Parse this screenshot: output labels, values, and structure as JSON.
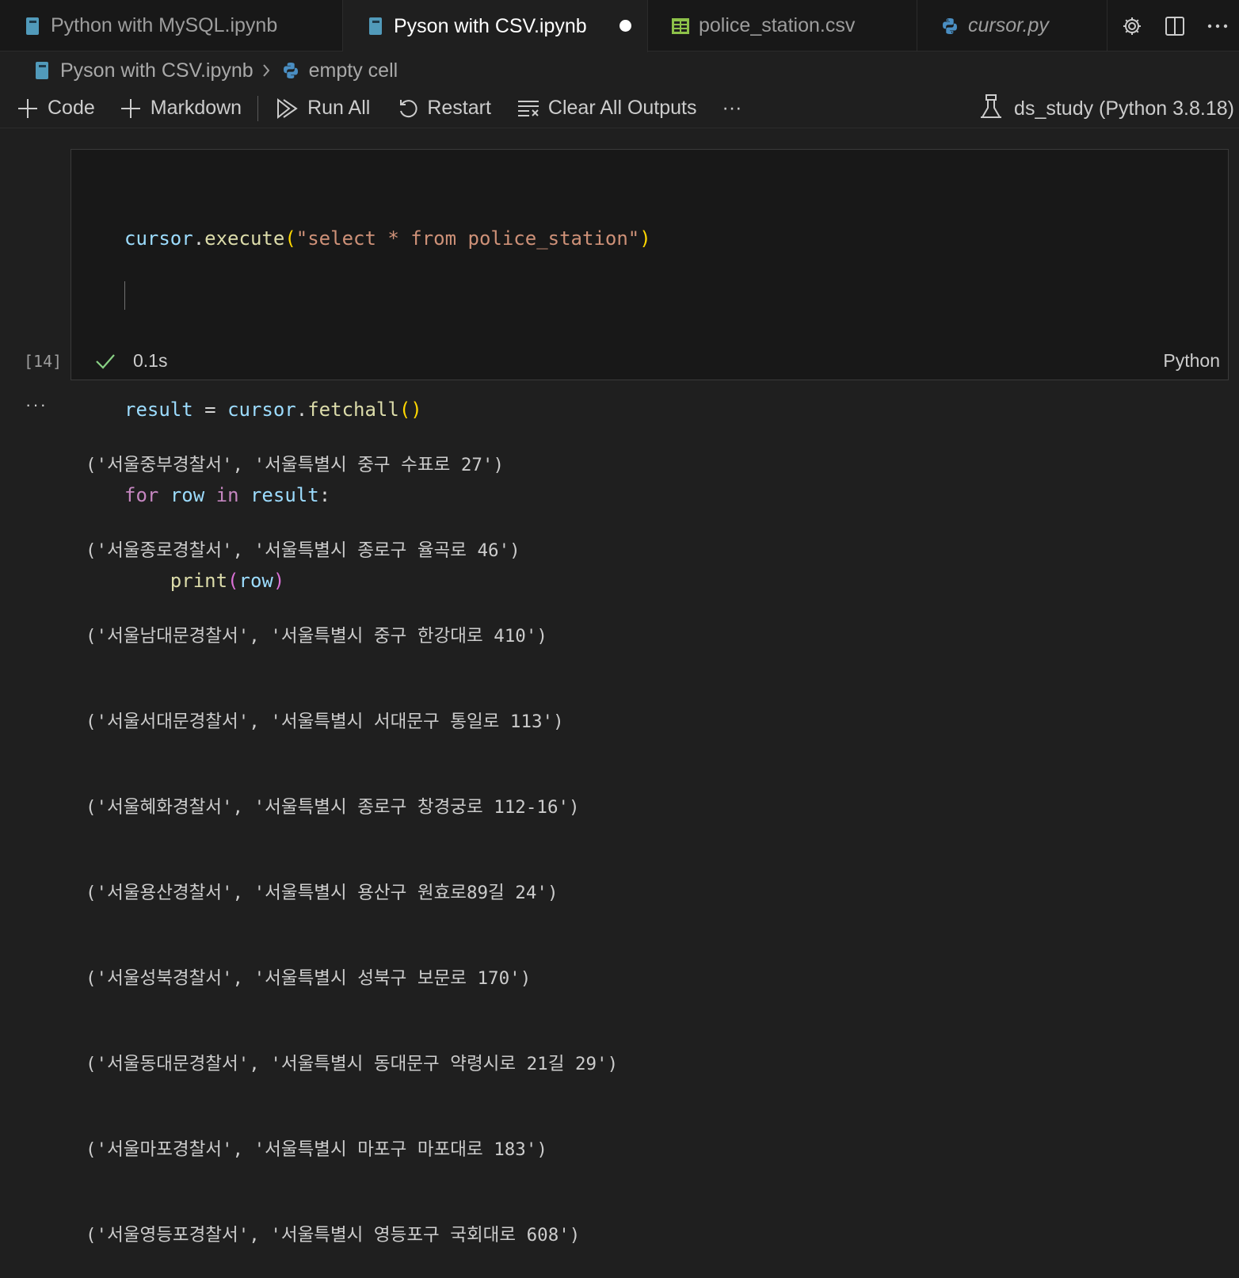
{
  "tabs": [
    {
      "label": "Python with MySQL.ipynb",
      "icon": "notebook-icon",
      "active": false
    },
    {
      "label": "Pyson with CSV.ipynb",
      "icon": "notebook-icon",
      "active": true,
      "dirty": true
    },
    {
      "label": "police_station.csv",
      "icon": "table-icon",
      "active": false
    },
    {
      "label": "cursor.py",
      "icon": "python-icon",
      "active": false
    }
  ],
  "breadcrumb": {
    "file": "Pyson with CSV.ipynb",
    "item": "empty cell"
  },
  "toolbar": {
    "code": "Code",
    "markdown": "Markdown",
    "run_all": "Run All",
    "restart": "Restart",
    "clear_outputs": "Clear All Outputs",
    "more": "···",
    "kernel": "ds_study (Python 3.8.18)"
  },
  "cell": {
    "exec_count": "[14]",
    "duration": "0.1s",
    "language": "Python",
    "code": {
      "l1_obj": "cursor",
      "l1_dot": ".",
      "l1_fn": "execute",
      "l1_open": "(",
      "l1_str": "\"select * from police_station\"",
      "l1_close": ")",
      "l3_var": "result",
      "l3_eq": " = ",
      "l3_obj": "cursor",
      "l3_dot": ".",
      "l3_fn": "fetchall",
      "l3_parens": "()",
      "l4_for": "for",
      "l4_sp1": " ",
      "l4_row": "row",
      "l4_sp2": " ",
      "l4_in": "in",
      "l4_sp3": " ",
      "l4_result": "result",
      "l4_colon": ":",
      "l5_indent": "    ",
      "l5_fn": "print",
      "l5_open": "(",
      "l5_arg": "row",
      "l5_close": ")"
    }
  },
  "output": {
    "ellipsis": "···",
    "rows": [
      "('서울중부경찰서', '서울특별시 중구 수표로 27')",
      "('서울종로경찰서', '서울특별시 종로구 율곡로 46')",
      "('서울남대문경찰서', '서울특별시 중구 한강대로 410')",
      "('서울서대문경찰서', '서울특별시 서대문구 통일로 113')",
      "('서울혜화경찰서', '서울특별시 종로구 창경궁로 112-16')",
      "('서울용산경찰서', '서울특별시 용산구 원효로89길 24')",
      "('서울성북경찰서', '서울특별시 성북구 보문로 170')",
      "('서울동대문경찰서', '서울특별시 동대문구 약령시로 21길 29')",
      "('서울마포경찰서', '서울특별시 마포구 마포대로 183')",
      "('서울영등포경찰서', '서울특별시 영등포구 국회대로 608')"
    ]
  },
  "colors": {
    "background": "#1f1f1f",
    "tab_bar": "#181818",
    "notebook_icon": "#519aba",
    "csv_icon": "#8dc149",
    "python_icon": "#4a8ec2",
    "success_check": "#89d185"
  }
}
